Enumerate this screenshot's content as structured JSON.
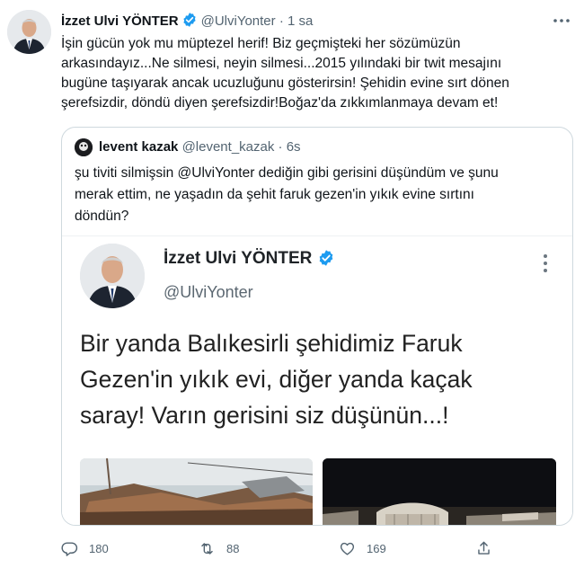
{
  "tweet": {
    "author_name": "İzzet Ulvi YÖNTER",
    "author_handle": "@UlviYonter",
    "separator": "·",
    "time": "1 sa",
    "text": "İşin gücün yok mu müptezel herif! Biz geçmişteki her sözümüzün\narkasındayız...Ne silmesi, neyin silmesi...2015 yılındaki bir twit mesajını\nbugüne taşıyarak ancak ucuzluğunu gösterirsin! Şehidin evine sırt dönen\nşerefsizdir, döndü diyen şerefsizdir!Boğaz'da zıkkımlanmaya devam et!"
  },
  "quote": {
    "author_name": "levent kazak",
    "author_handle": "@levent_kazak",
    "separator": "·",
    "time": "6s",
    "text": "şu tiviti silmişsin @UlviYonter dediğin gibi gerisini düşündüm ve şunu\nmerak ettim, ne yaşadın da şehit faruk gezen'in yıkık evine sırtını\ndöndün?",
    "screenshot": {
      "name": "İzzet Ulvi YÖNTER",
      "handle": "@UlviYonter",
      "text": "Bir yanda Balıkesirli şehidimiz Faruk\nGezen'in yıkık evi, diğer yanda kaçak\nsaray! Varın gerisini siz düşünün...!"
    }
  },
  "actions": {
    "reply_count": "180",
    "retweet_count": "88",
    "like_count": "169"
  },
  "icons": {
    "verified": "verified-badge-icon",
    "more": "more-dots-icon",
    "reply": "reply-icon",
    "retweet": "retweet-icon",
    "like": "like-icon",
    "share": "share-icon"
  },
  "colors": {
    "accent": "#1d9bf0",
    "text_primary": "#0f1419",
    "text_secondary": "#536471",
    "border": "#cfd9de"
  }
}
